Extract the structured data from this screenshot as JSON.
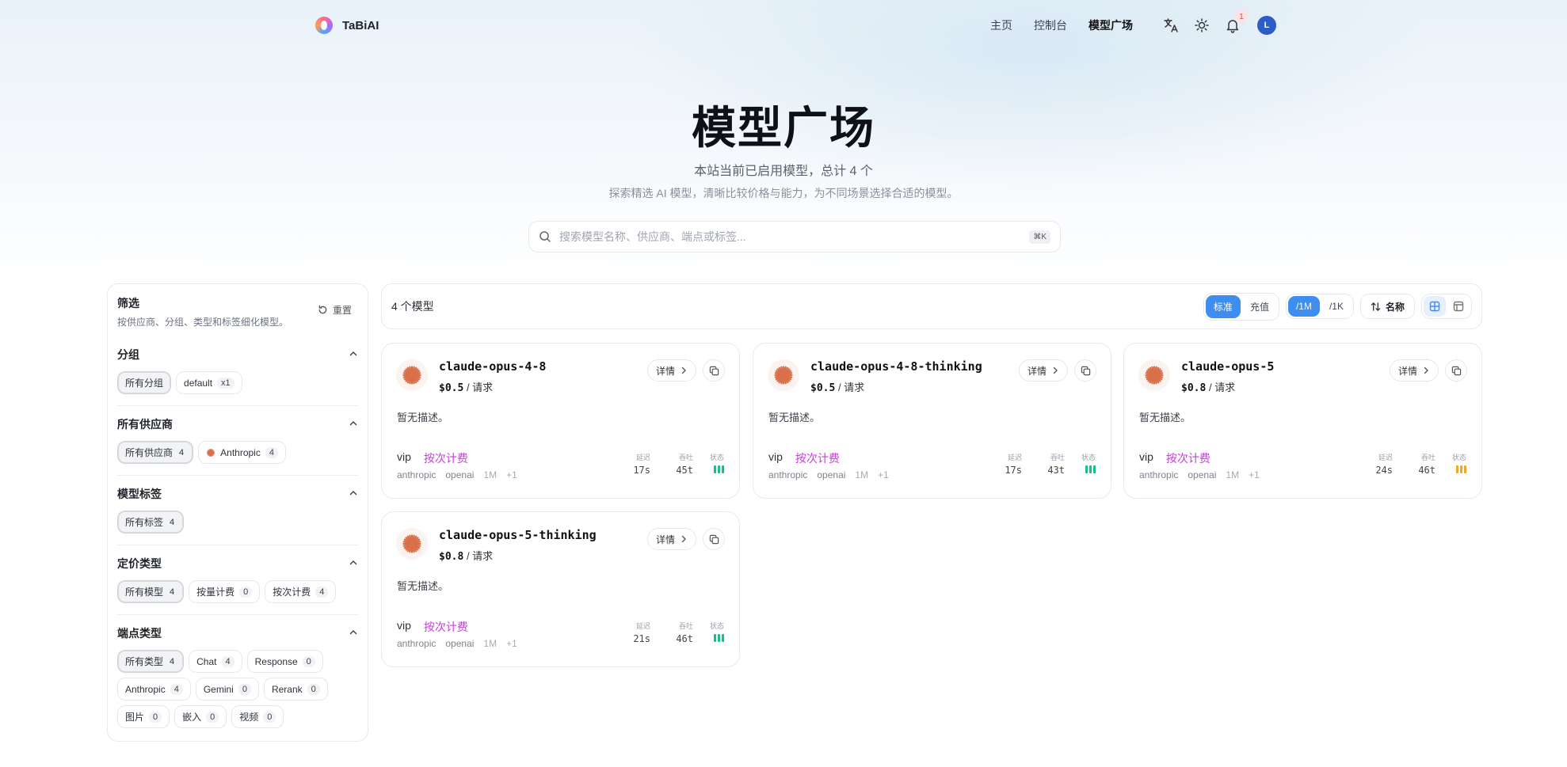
{
  "app": {
    "name": "TaBiAI"
  },
  "nav": {
    "links": [
      {
        "label": "主页"
      },
      {
        "label": "控制台"
      },
      {
        "label": "模型广场"
      }
    ],
    "notification_count": "1",
    "avatar_initial": "L"
  },
  "hero": {
    "title": "模型广场",
    "subtitle": "本站当前已启用模型，总计 4 个",
    "description": "探索精选 AI 模型，清晰比较价格与能力，为不同场景选择合适的模型。",
    "search_placeholder": "搜索模型名称、供应商、端点或标签...",
    "search_shortcut": "⌘K"
  },
  "filters": {
    "title": "筛选",
    "description": "按供应商、分组、类型和标签细化模型。",
    "reset_label": "重置",
    "groups": [
      {
        "title": "分组",
        "chips": [
          {
            "label": "所有分组",
            "count": "",
            "active": true
          },
          {
            "label": "default",
            "count": "x1",
            "active": false
          }
        ]
      },
      {
        "title": "所有供应商",
        "chips": [
          {
            "label": "所有供应商",
            "count": "4",
            "active": true
          },
          {
            "label": "Anthropic",
            "count": "4",
            "active": false,
            "icon": "anthropic-icon"
          }
        ]
      },
      {
        "title": "模型标签",
        "chips": [
          {
            "label": "所有标签",
            "count": "4",
            "active": true
          }
        ]
      },
      {
        "title": "定价类型",
        "chips": [
          {
            "label": "所有模型",
            "count": "4",
            "active": true
          },
          {
            "label": "按量计费",
            "count": "0",
            "active": false
          },
          {
            "label": "按次计费",
            "count": "4",
            "active": false
          }
        ]
      },
      {
        "title": "端点类型",
        "chips": [
          {
            "label": "所有类型",
            "count": "4",
            "active": true
          },
          {
            "label": "Chat",
            "count": "4",
            "active": false
          },
          {
            "label": "Response",
            "count": "0",
            "active": false
          },
          {
            "label": "Anthropic",
            "count": "4",
            "active": false
          },
          {
            "label": "Gemini",
            "count": "0",
            "active": false
          },
          {
            "label": "Rerank",
            "count": "0",
            "active": false
          },
          {
            "label": "图片",
            "count": "0",
            "active": false
          },
          {
            "label": "嵌入",
            "count": "0",
            "active": false
          },
          {
            "label": "视频",
            "count": "0",
            "active": false
          }
        ]
      }
    ]
  },
  "toolbar": {
    "count_label": "4 个模型",
    "price_mode": [
      {
        "label": "标准",
        "active": true
      },
      {
        "label": "充值",
        "active": false
      }
    ],
    "unit": [
      {
        "label": "/1M",
        "active": true
      },
      {
        "label": "/1K",
        "active": false
      }
    ],
    "sort_label": "名称",
    "view": "grid"
  },
  "colors": {
    "accent": "#3d8ef0",
    "billing": "#c63fd8",
    "anthropic": "#d9704a",
    "status_green": "#16c08a",
    "status_orange": "#f5a623"
  },
  "models": [
    {
      "name": "claude-opus-4-8",
      "price": "$0.5",
      "unit": "/ 请求",
      "description": "暂无描述。",
      "group": "vip",
      "billing": "按次计费",
      "tags": [
        "anthropic",
        "openai",
        "1M",
        "+1"
      ],
      "latency_label": "延迟",
      "latency": "17s",
      "throughput_label": "吞吐",
      "throughput": "45t",
      "status_label": "状态",
      "status": "green",
      "detail_label": "详情"
    },
    {
      "name": "claude-opus-4-8-thinking",
      "price": "$0.5",
      "unit": "/ 请求",
      "description": "暂无描述。",
      "group": "vip",
      "billing": "按次计费",
      "tags": [
        "anthropic",
        "openai",
        "1M",
        "+1"
      ],
      "latency_label": "延迟",
      "latency": "17s",
      "throughput_label": "吞吐",
      "throughput": "43t",
      "status_label": "状态",
      "status": "green",
      "detail_label": "详情"
    },
    {
      "name": "claude-opus-5",
      "price": "$0.8",
      "unit": "/ 请求",
      "description": "暂无描述。",
      "group": "vip",
      "billing": "按次计费",
      "tags": [
        "anthropic",
        "openai",
        "1M",
        "+1"
      ],
      "latency_label": "延迟",
      "latency": "24s",
      "throughput_label": "吞吐",
      "throughput": "46t",
      "status_label": "状态",
      "status": "orange",
      "detail_label": "详情"
    },
    {
      "name": "claude-opus-5-thinking",
      "price": "$0.8",
      "unit": "/ 请求",
      "description": "暂无描述。",
      "group": "vip",
      "billing": "按次计费",
      "tags": [
        "anthropic",
        "openai",
        "1M",
        "+1"
      ],
      "latency_label": "延迟",
      "latency": "21s",
      "throughput_label": "吞吐",
      "throughput": "46t",
      "status_label": "状态",
      "status": "green",
      "detail_label": "详情"
    }
  ]
}
